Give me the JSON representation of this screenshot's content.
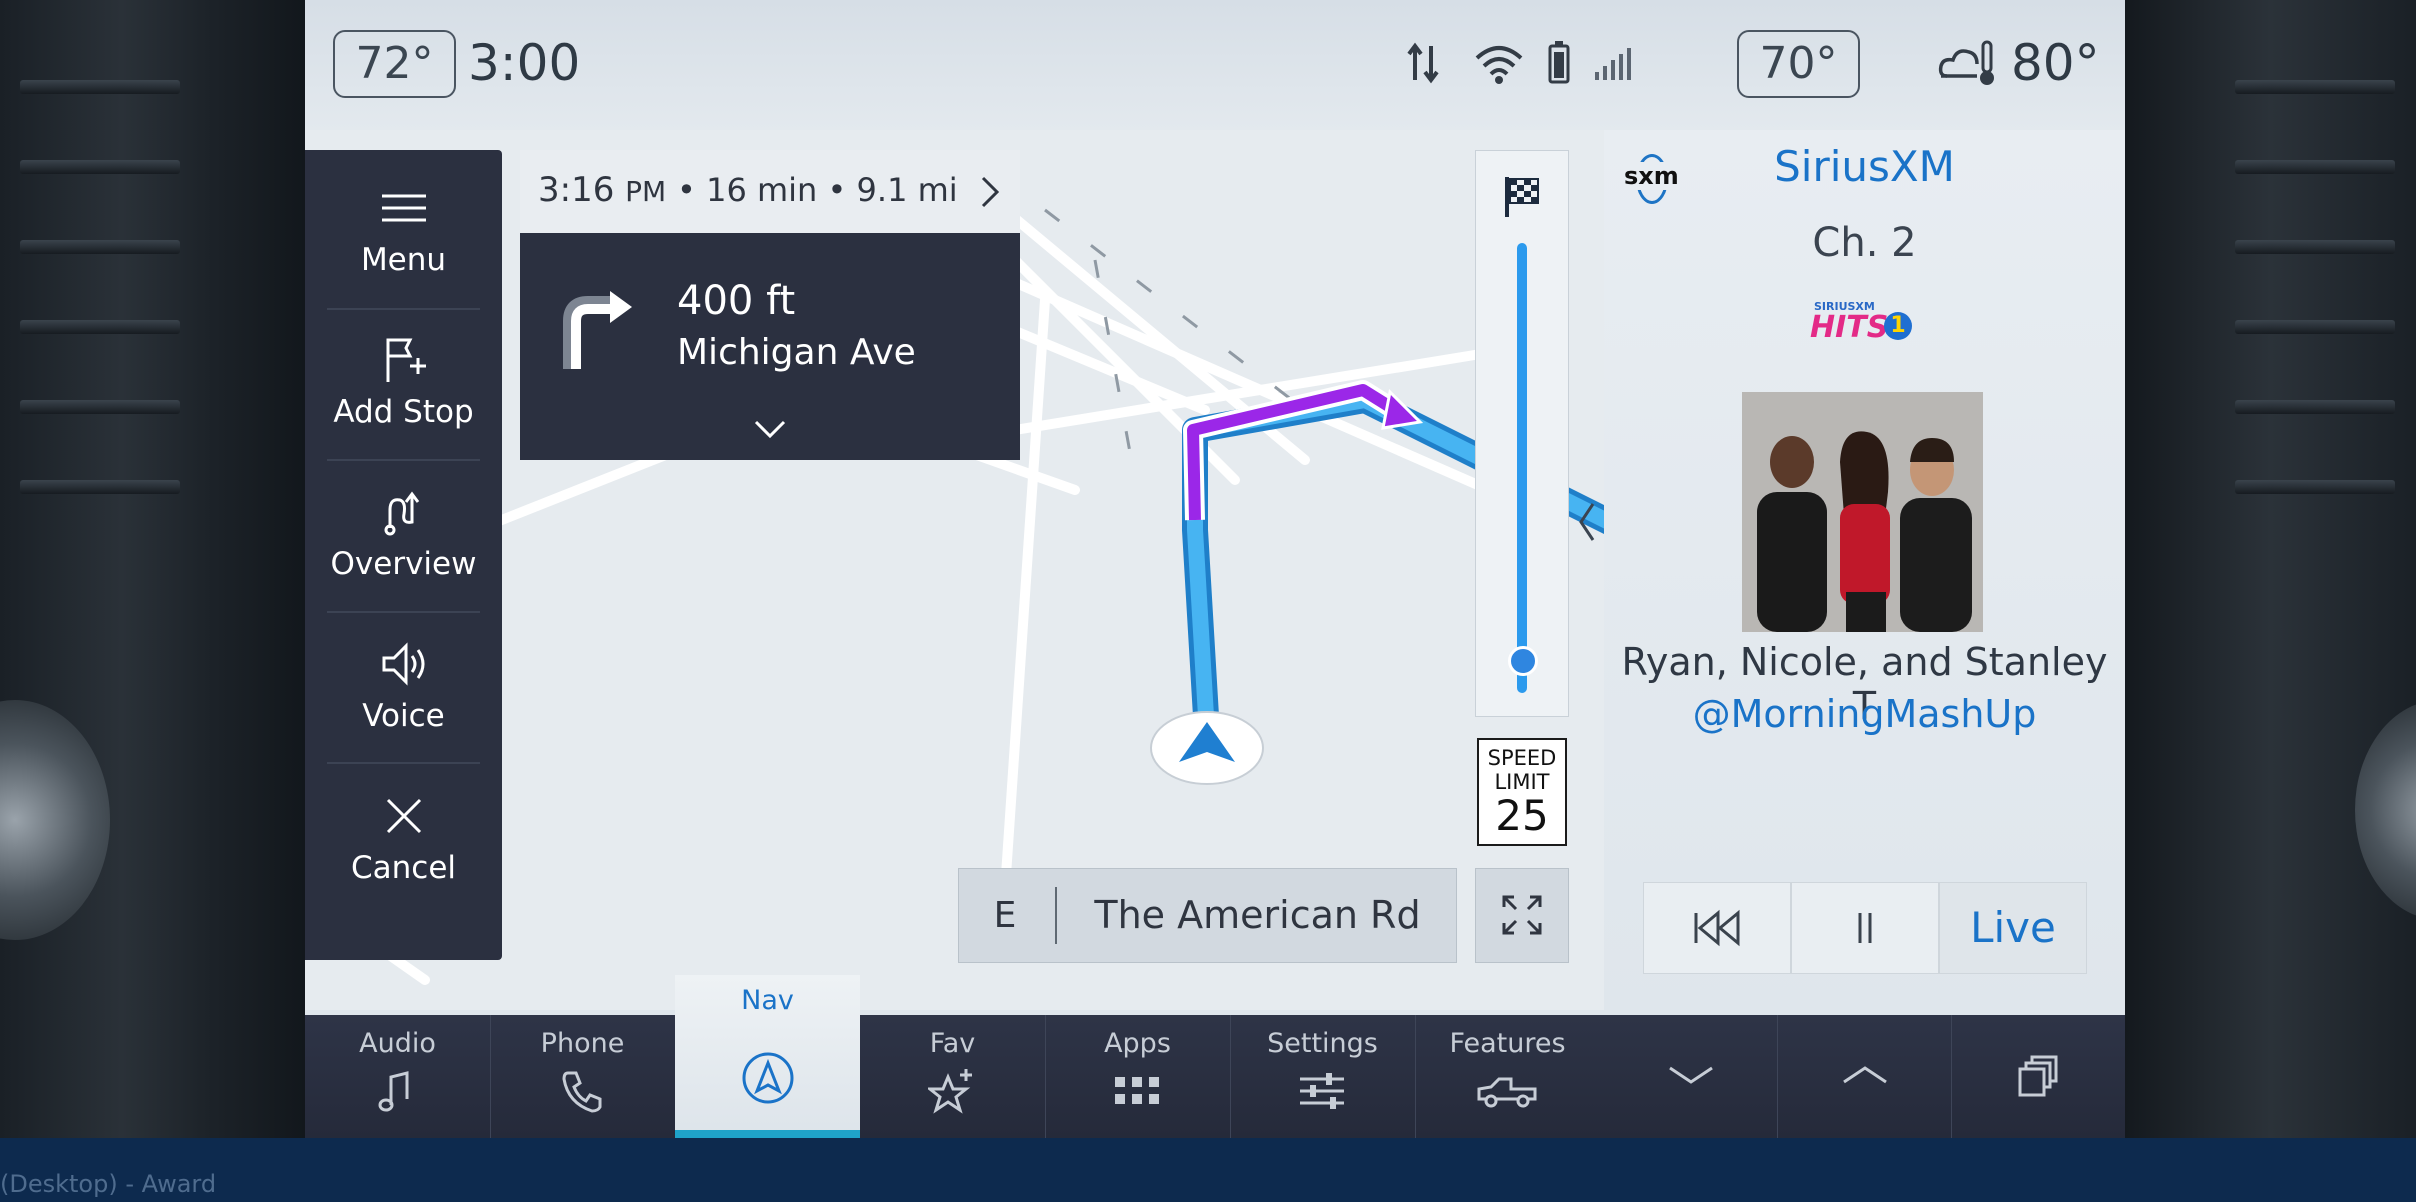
{
  "status": {
    "cabin_temp_left": "72°",
    "time": "3:00",
    "cabin_temp_right": "70°",
    "outside_temp": "80°"
  },
  "nav_menu": {
    "items": [
      {
        "label": "Menu",
        "icon": "hamburger-icon"
      },
      {
        "label": "Add Stop",
        "icon": "flag-plus-icon"
      },
      {
        "label": "Overview",
        "icon": "route-overview-icon"
      },
      {
        "label": "Voice",
        "icon": "speaker-icon"
      },
      {
        "label": "Cancel",
        "icon": "close-icon"
      }
    ]
  },
  "route": {
    "eta_time": "3:16",
    "eta_ampm": "PM",
    "eta_duration": "• 16 min • 9.1 mi",
    "turn_distance": "400 ft",
    "turn_street": "Michigan Ave"
  },
  "speed_limit": {
    "line1": "SPEED",
    "line2": "LIMIT",
    "value": "25"
  },
  "road_bar": {
    "heading": "E",
    "current_road": "The American Rd"
  },
  "media": {
    "source": "SiriusXM",
    "channel": "Ch. 2",
    "logo_text": "sxm",
    "channel_logo_top": "SIRIUSXM",
    "channel_logo_main": "HITS",
    "channel_logo_num": "1",
    "artist": "Ryan, Nicole, and Stanley T",
    "handle": "@MorningMashUp",
    "live_label": "Live"
  },
  "dock": {
    "items": [
      {
        "label": "Audio",
        "icon": "music-note-icon"
      },
      {
        "label": "Phone",
        "icon": "phone-icon"
      },
      {
        "label": "Nav",
        "icon": "navigation-icon"
      },
      {
        "label": "Fav",
        "icon": "star-plus-icon"
      },
      {
        "label": "Apps",
        "icon": "grid-icon"
      },
      {
        "label": "Settings",
        "icon": "sliders-icon"
      },
      {
        "label": "Features",
        "icon": "truck-icon"
      }
    ]
  },
  "taskbar": {
    "text": "(Desktop) - Award"
  },
  "colors": {
    "route_blue": "#2e9ae6",
    "route_purple": "#9b27e8",
    "accent_blue": "#1a73c8",
    "panel_dark": "#2b3040"
  }
}
